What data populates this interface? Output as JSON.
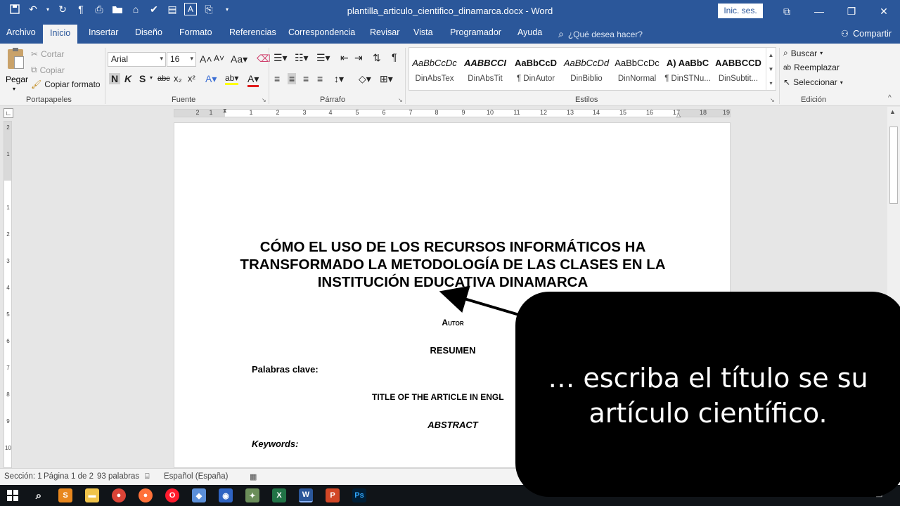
{
  "app": {
    "window_title": "plantilla_articulo_cientifico_dinamarca.docx  -  Word",
    "signin_label": "Inic. ses.",
    "qat_icons": [
      "save-icon",
      "undo-icon",
      "redo-icon",
      "paragraph-marks-icon",
      "print-preview-icon",
      "open-folder-icon",
      "spelling-icon",
      "check-icon",
      "page-icon",
      "text-a-icon",
      "customize-icon"
    ]
  },
  "tabs": [
    "Archivo",
    "Inicio",
    "Insertar",
    "Diseño",
    "Formato",
    "Referencias",
    "Correspondencia",
    "Revisar",
    "Vista",
    "Programador",
    "Ayuda"
  ],
  "active_tab": "Inicio",
  "tellme": {
    "placeholder": "¿Qué desea hacer?"
  },
  "share_label": "Compartir",
  "ribbon": {
    "clipboard": {
      "paste": "Pegar",
      "cut": "Cortar",
      "copy": "Copiar",
      "format_painter": "Copiar formato",
      "group_label": "Portapapeles"
    },
    "font": {
      "family": "Arial",
      "size": "16",
      "group_label": "Fuente",
      "bold": "N",
      "italic": "K",
      "underline": "S",
      "strike": "abc",
      "subscript": "x₂",
      "superscript": "x²"
    },
    "paragraph": {
      "group_label": "Párrafo"
    },
    "styles": {
      "group_label": "Estilos",
      "items": [
        {
          "sample": "AaBbCcDc",
          "name": "DinAbsTex"
        },
        {
          "sample": "AABBCCI",
          "name": "DinAbsTit"
        },
        {
          "sample": "AaBbCcD",
          "name": "¶ DinAutor"
        },
        {
          "sample": "AaBbCcDd",
          "name": "DinBiblio"
        },
        {
          "sample": "AaBbCcDc",
          "name": "DinNormal"
        },
        {
          "sample": "A) AaBbC",
          "name": "¶ DinSTNu..."
        },
        {
          "sample": "AABBCCD",
          "name": "DinSubtit..."
        }
      ]
    },
    "editing": {
      "find": "Buscar",
      "replace": "Reemplazar",
      "select": "Seleccionar",
      "group_label": "Edición"
    }
  },
  "ruler": {
    "h_numbers": [
      "2",
      "1",
      "1",
      "2",
      "3",
      "4",
      "5",
      "6",
      "7",
      "8",
      "9",
      "10",
      "11",
      "12",
      "13",
      "14",
      "15",
      "16",
      "17",
      "18",
      "19"
    ],
    "v_numbers": [
      "2",
      "1",
      "1",
      "2",
      "3",
      "4",
      "5",
      "6",
      "7",
      "8",
      "9",
      "10"
    ]
  },
  "document": {
    "title": "CÓMO EL USO DE LOS RECURSOS INFORMÁTICOS HA TRANSFORMADO LA METODOLOGÍA DE LAS CLASES EN LA INSTITUCIÓN EDUCATIVA DINAMARCA",
    "author": "Autor",
    "resumen": "RESUMEN",
    "palabras_clave": "Palabras clave:",
    "title_english": "TITLE OF THE ARTICLE IN ENGL",
    "abstract": "ABSTRACT",
    "keywords": "Keywords:"
  },
  "status": {
    "section": "Sección: 1",
    "page": "Página 1 de 2",
    "words": "93 palabras",
    "language": "Español (España)"
  },
  "callout": {
    "text": "… escriba el título se su artículo científico."
  },
  "taskbar": {
    "apps": [
      "windows-start-icon",
      "search-icon",
      "sublime-icon",
      "explorer-icon",
      "chrome-icon",
      "firefox-icon",
      "opera-icon",
      "app-icon",
      "app-icon-2",
      "app-icon-3",
      "excel-icon",
      "word-icon",
      "powerpoint-icon",
      "photoshop-icon"
    ]
  }
}
